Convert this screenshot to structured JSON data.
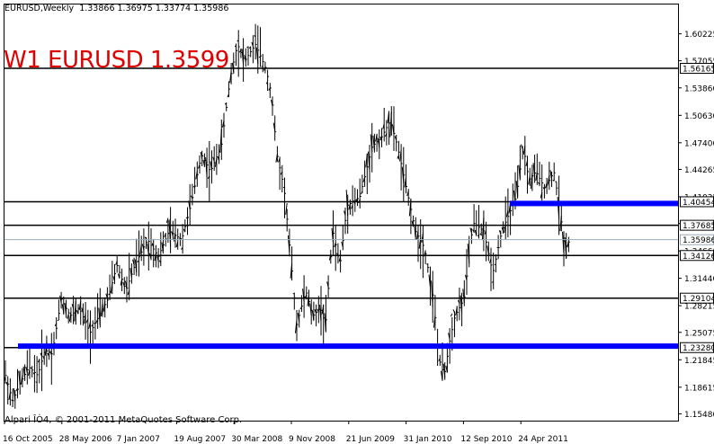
{
  "header": {
    "symbol_line": "EURUSD,Weekly  1.33866 1.36975 1.33774 1.35986",
    "big_label": "W1 EURUSD 1.3599",
    "copyright": "Alpari ÎÒ4, © 2001-2011 MetaQuotes Software Corp."
  },
  "chart_data": {
    "type": "bar",
    "style": "OHLC weekly bars",
    "ylim": [
      1.1468,
      1.6368
    ],
    "y_ticks": [
      "1.60225",
      "1.57055",
      "1.53860",
      "1.50630",
      "1.47400",
      "1.44265",
      "1.41035",
      "1.37885",
      "1.34660",
      "1.31440",
      "1.28215",
      "1.25075",
      "1.21845",
      "1.18615",
      "1.15480"
    ],
    "x_ticks": [
      "16 Oct 2005",
      "28 May 2006",
      "7 Jan 2007",
      "19 Aug 2007",
      "30 Mar 2008",
      "9 Nov 2008",
      "21 Jun 2009",
      "31 Jan 2010",
      "12 Sep 2010",
      "24 Apr 2011"
    ],
    "horizontal_levels": [
      {
        "label": "1.56165",
        "value": 1.56165,
        "color": "#000000",
        "boxed": true
      },
      {
        "label": "1.40454",
        "value": 1.40454,
        "color": "#000000",
        "boxed": true
      },
      {
        "label": "1.37685",
        "value": 1.37685,
        "color": "#000000",
        "boxed": true
      },
      {
        "label": "1.35986",
        "value": 1.35986,
        "color": "#9aa8b8",
        "boxed": true
      },
      {
        "label": "1.34126",
        "value": 1.34126,
        "color": "#000000",
        "boxed": true
      },
      {
        "label": "1.29104",
        "value": 1.29104,
        "color": "#000000",
        "boxed": true
      },
      {
        "label": "1.23280",
        "value": 1.2328,
        "color": "#000000",
        "boxed": true
      }
    ],
    "zones": [
      {
        "value": 1.2345,
        "from": "16 Oct 2005",
        "to": "end",
        "color": "#0000ff"
      },
      {
        "value": 1.4025,
        "from": "12 Sep 2010",
        "to": "end",
        "color": "#0000ff"
      }
    ],
    "price_path": [
      [
        0,
        1.2
      ],
      [
        8,
        1.17
      ],
      [
        16,
        1.19
      ],
      [
        26,
        1.21
      ],
      [
        36,
        1.2
      ],
      [
        44,
        1.23
      ],
      [
        52,
        1.225
      ],
      [
        62,
        1.29
      ],
      [
        72,
        1.27
      ],
      [
        82,
        1.28
      ],
      [
        94,
        1.25
      ],
      [
        104,
        1.27
      ],
      [
        114,
        1.29
      ],
      [
        124,
        1.33
      ],
      [
        134,
        1.3
      ],
      [
        144,
        1.33
      ],
      [
        158,
        1.36
      ],
      [
        170,
        1.34
      ],
      [
        182,
        1.37
      ],
      [
        196,
        1.36
      ],
      [
        206,
        1.4
      ],
      [
        218,
        1.46
      ],
      [
        228,
        1.44
      ],
      [
        240,
        1.47
      ],
      [
        250,
        1.55
      ],
      [
        258,
        1.59
      ],
      [
        266,
        1.57
      ],
      [
        278,
        1.59
      ],
      [
        290,
        1.56
      ],
      [
        296,
        1.53
      ],
      [
        302,
        1.46
      ],
      [
        310,
        1.42
      ],
      [
        318,
        1.33
      ],
      [
        324,
        1.26
      ],
      [
        334,
        1.3
      ],
      [
        342,
        1.27
      ],
      [
        350,
        1.28
      ],
      [
        356,
        1.26
      ],
      [
        364,
        1.37
      ],
      [
        372,
        1.33
      ],
      [
        380,
        1.4
      ],
      [
        394,
        1.41
      ],
      [
        408,
        1.47
      ],
      [
        418,
        1.48
      ],
      [
        428,
        1.5
      ],
      [
        436,
        1.47
      ],
      [
        446,
        1.42
      ],
      [
        456,
        1.37
      ],
      [
        466,
        1.35
      ],
      [
        476,
        1.29
      ],
      [
        482,
        1.22
      ],
      [
        488,
        1.2
      ],
      [
        494,
        1.24
      ],
      [
        500,
        1.27
      ],
      [
        510,
        1.29
      ],
      [
        520,
        1.38
      ],
      [
        532,
        1.37
      ],
      [
        542,
        1.32
      ],
      [
        552,
        1.37
      ],
      [
        560,
        1.39
      ],
      [
        568,
        1.41
      ],
      [
        576,
        1.47
      ],
      [
        582,
        1.43
      ],
      [
        590,
        1.44
      ],
      [
        600,
        1.42
      ],
      [
        610,
        1.44
      ],
      [
        616,
        1.4
      ],
      [
        622,
        1.35
      ],
      [
        628,
        1.3599
      ]
    ]
  }
}
